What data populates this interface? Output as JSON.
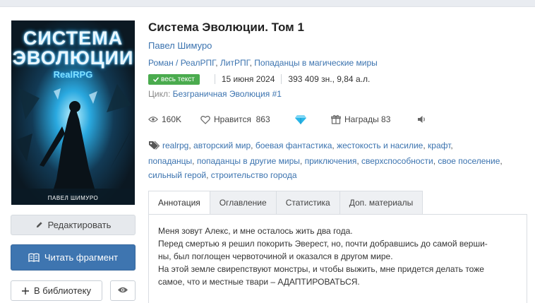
{
  "book": {
    "title": "Система Эволюции. Том 1",
    "author": "Павел Шимуро",
    "genres": [
      "Роман / РеалРПГ",
      "ЛитРПГ",
      "Попаданцы в магические миры"
    ],
    "badge": "весь текст",
    "date": "15 июня 2024",
    "size": "393 409 зн., 9,84 а.л.",
    "cycle_label": "Цикл:",
    "cycle_name": "Безграничная Эволюция #1"
  },
  "cover": {
    "title_line1": "СИСТЕМА",
    "title_line2": "ЭВОЛЮЦИИ",
    "subtitle": "RealRPG",
    "author": "ПАВЕЛ ШИМУРО"
  },
  "stats": {
    "views": "160K",
    "likes_label": "Нравится",
    "likes_count": "863",
    "awards_label": "Награды",
    "awards_count": "83"
  },
  "tags": [
    "realrpg",
    "авторский мир",
    "боевая фантастика",
    "жестокость и насилие",
    "крафт",
    "попаданцы",
    "попаданцы в другие миры",
    "приключения",
    "сверхспособности",
    "свое поселение",
    "сильный герой",
    "строительство города"
  ],
  "actions": {
    "edit": "Редактировать",
    "read": "Читать фрагмент",
    "library": "В библиотеку"
  },
  "tabs": [
    "Аннотация",
    "Оглавление",
    "Статистика",
    "Доп. материалы"
  ],
  "annotation": [
    "Меня зовут Алекс, и мне осталось жить два года.",
    "Перед смертью я решил покорить Эверест, но, почти добравшись до самой верши-",
    "ны, был поглощен червоточиной и оказался в другом мире.",
    "На этой земле свирепствуют монстры, и чтобы выжить, мне придется делать тоже",
    "самое, что и местные твари – АДАПТИРОВАТЬСЯ."
  ],
  "colors": {
    "link": "#3b73af",
    "read_button": "#3e75b0",
    "badge": "#4aab4e",
    "diamond": "#29b6e8"
  }
}
